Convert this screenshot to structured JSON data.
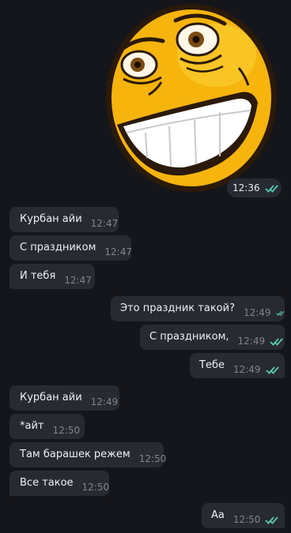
{
  "sticker": {
    "time": "12:36"
  },
  "messages": [
    {
      "dir": "in",
      "text": "Курбан айи",
      "time": "12:47"
    },
    {
      "dir": "in",
      "text": "С праздником",
      "time": "12:47"
    },
    {
      "dir": "in",
      "text": "И тебя",
      "time": "12:47"
    },
    {
      "dir": "out",
      "text": "Это праздник такой?",
      "time": "12:49"
    },
    {
      "dir": "out",
      "text": "С праздником,",
      "time": "12:49"
    },
    {
      "dir": "out",
      "text": "Тебе",
      "time": "12:49"
    },
    {
      "dir": "in",
      "text": "Курбан айи",
      "time": "12:49"
    },
    {
      "dir": "in",
      "text": "*айт",
      "time": "12:50"
    },
    {
      "dir": "in",
      "text": "Там барашек режем",
      "time": "12:50"
    },
    {
      "dir": "in",
      "text": "Все такое",
      "time": "12:50"
    },
    {
      "dir": "out",
      "text": "Аа",
      "time": "12:50"
    }
  ],
  "colors": {
    "read_ticks": "#5ac8b0",
    "bubble": "#272a31",
    "background": "#15161b"
  }
}
